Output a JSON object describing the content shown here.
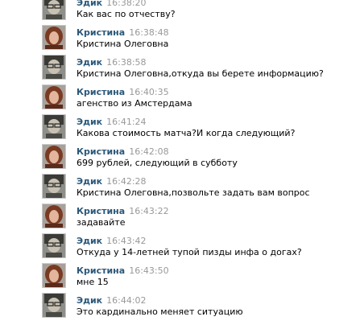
{
  "messages": [
    {
      "author": "Эдик",
      "time": "16:38:20",
      "text": "Как вас по отчеству?",
      "avatar": "man-avatar"
    },
    {
      "author": "Кристина",
      "time": "16:38:48",
      "text": "Кристина Олеговна",
      "avatar": "woman-avatar"
    },
    {
      "author": "Эдик",
      "time": "16:38:58",
      "text": "Кристина Олеговна,откуда вы берете информацию?",
      "avatar": "man-avatar"
    },
    {
      "author": "Кристина",
      "time": "16:40:35",
      "text": "агенство из Амстердама",
      "avatar": "woman-avatar"
    },
    {
      "author": "Эдик",
      "time": "16:41:24",
      "text": "Какова стоимость матча?И когда следующий?",
      "avatar": "man-avatar"
    },
    {
      "author": "Кристина",
      "time": "16:42:08",
      "text": "699 рублей, следующий в субботу",
      "avatar": "woman-avatar"
    },
    {
      "author": "Эдик",
      "time": "16:42:28",
      "text": "Кристина Олеговна,позвольте задать вам вопрос",
      "avatar": "man-avatar"
    },
    {
      "author": "Кристина",
      "time": "16:43:22",
      "text": "задавайте",
      "avatar": "woman-avatar"
    },
    {
      "author": "Эдик",
      "time": "16:43:42",
      "text": "Откуда у 14-летней тупой пизды инфа о догах?",
      "avatar": "man-avatar"
    },
    {
      "author": "Кристина",
      "time": "16:43:50",
      "text": "мне 15",
      "avatar": "woman-avatar"
    },
    {
      "author": "Эдик",
      "time": "16:44:02",
      "text": "Это кардинально меняет ситуацию",
      "avatar": "man-avatar"
    }
  ]
}
